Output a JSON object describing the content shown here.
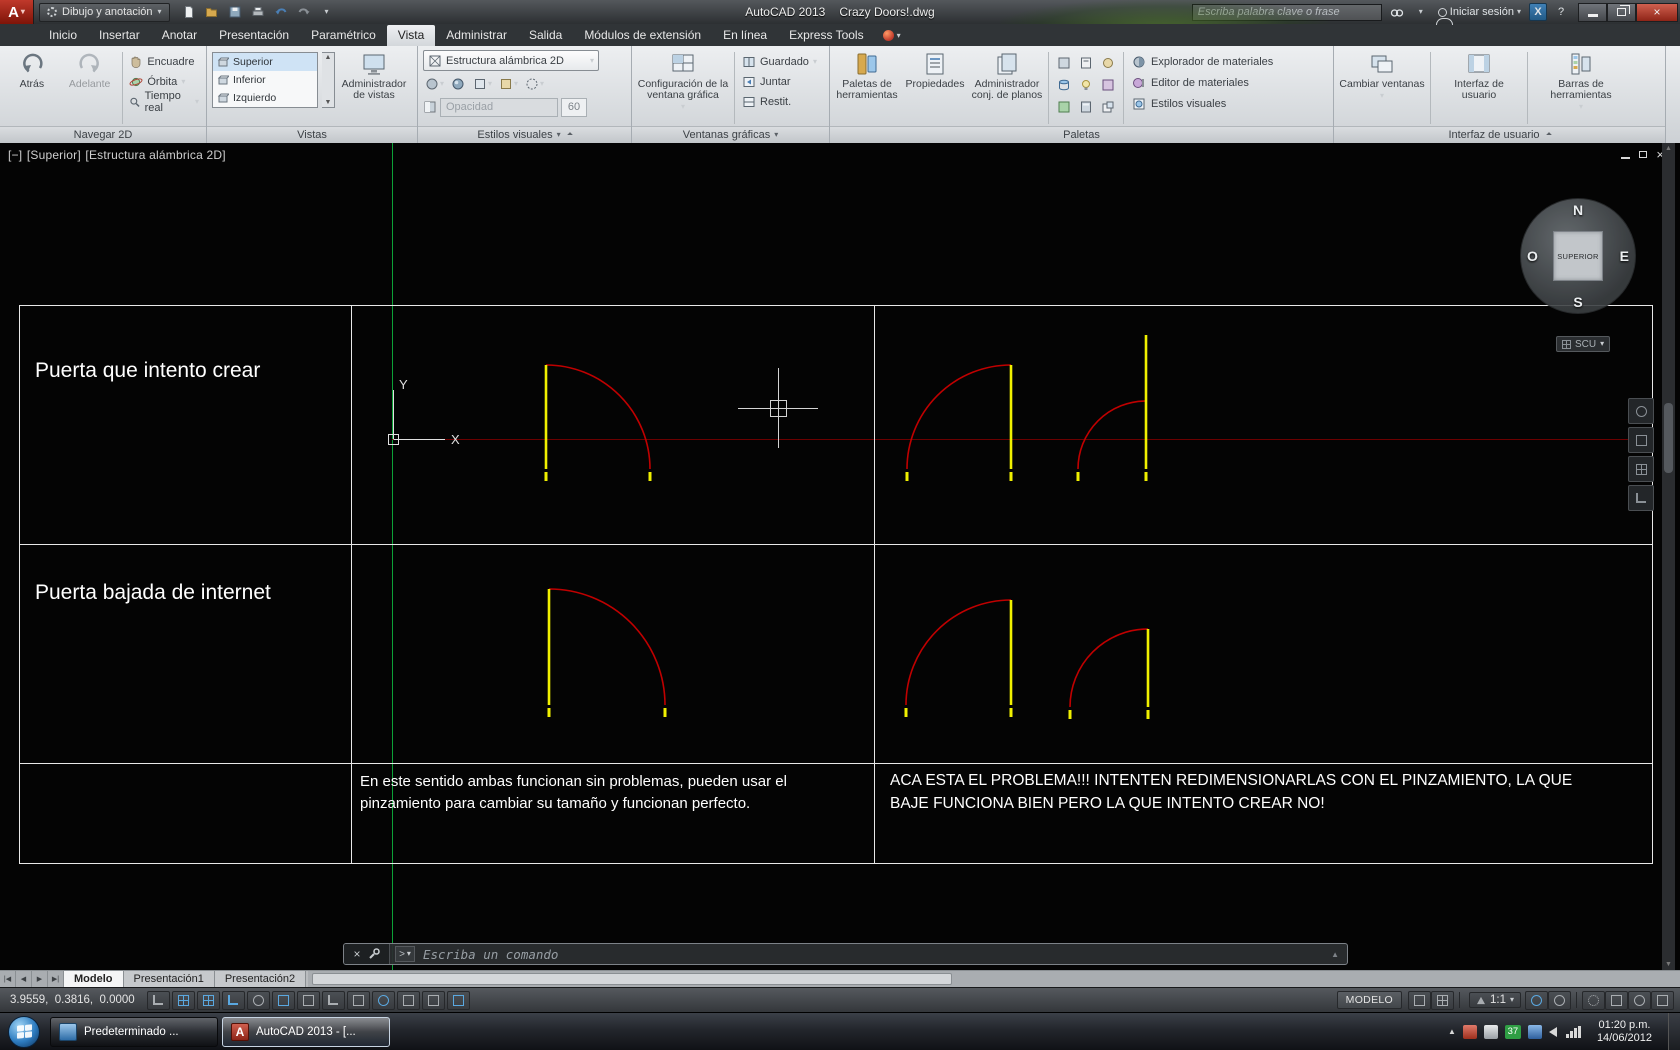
{
  "glyphs": {
    "dropdown": "▾",
    "close": "×",
    "up": "▲",
    "down": "▼",
    "tab_first": "|◀",
    "tab_prev": "◀",
    "tab_next": "▶",
    "tab_last": "▶|",
    "prompt": ">",
    "help": "?"
  },
  "title_bar": {
    "logo_letter": "A",
    "workspace": "Dibujo y anotación",
    "app_name": "AutoCAD 2013",
    "doc_name": "Crazy Doors!.dwg",
    "search_placeholder": "Escriba palabra clave o frase",
    "sign_in": "Iniciar sesión",
    "exchange_label": "X"
  },
  "menu": {
    "items": [
      "Inicio",
      "Insertar",
      "Anotar",
      "Presentación",
      "Paramétrico",
      "Vista",
      "Administrar",
      "Salida",
      "Módulos de extensión",
      "En línea",
      "Express Tools"
    ]
  },
  "ribbon": {
    "navegar": {
      "label": "Navegar 2D",
      "back": "Atrás",
      "forward": "Adelante",
      "pan": "Encuadre",
      "orbit": "Órbita",
      "realtime": "Tiempo real"
    },
    "vistas": {
      "label": "Vistas",
      "items": [
        "Superior",
        "Inferior",
        "Izquierdo"
      ],
      "manager": "Administrador de vistas"
    },
    "estilos": {
      "label": "Estilos visuales",
      "current": "Estructura alámbrica 2D",
      "opacity_label": "Opacidad",
      "opacity_value": "60"
    },
    "ventanas": {
      "label": "Ventanas gráficas",
      "config": "Configuración de la ventana gráfica",
      "saved": "Guardado",
      "join": "Juntar",
      "restore": "Restit."
    },
    "paletas": {
      "label": "Paletas",
      "tool_palettes": "Paletas de herramientas",
      "properties": "Propiedades",
      "sheet_set": "Administrador conj. de planos",
      "mat_browser": "Explorador de materiales",
      "mat_editor": "Editor de materiales",
      "visual_styles": "Estilos visuales"
    },
    "interfaz": {
      "label": "Interfaz de usuario",
      "switch_windows": "Cambiar ventanas",
      "user_interface": "Interfaz de usuario",
      "toolbars": "Barras de herramientas"
    }
  },
  "viewport": {
    "ctrl_minus": "[−]",
    "ctrl_view": "[Superior]",
    "ctrl_style": "[Estructura alámbrica 2D]",
    "cube_n": "N",
    "cube_e": "E",
    "cube_s": "S",
    "cube_o": "O",
    "cube_face": "SUPERIOR",
    "scu": "SCU",
    "ucs_x": "X",
    "ucs_y": "Y"
  },
  "canvas_table": {
    "row1_label": "Puerta que intento crear",
    "row2_label": "Puerta bajada de internet",
    "note_ok": "En este sentido ambas funcionan sin problemas, pueden usar el pinzamiento para cambiar su tamaño y funcionan perfecto.",
    "note_problem": "ACA ESTA EL PROBLEMA!!! INTENTEN REDIMENSIONARLAS CON EL PINZAMIENTO, LA QUE BAJE FUNCIONA BIEN PERO LA QUE INTENTO CREAR NO!"
  },
  "command_line": {
    "prompt": "Escriba un comando"
  },
  "layout_tabs": {
    "model": "Modelo",
    "p1": "Presentación1",
    "p2": "Presentación2"
  },
  "status_bar": {
    "coords": "3.9559,  0.3816,  0.0000",
    "modelo": "MODELO",
    "scale": "1:1"
  },
  "taskbar": {
    "app1": "Predeterminado ...",
    "app2": "AutoCAD 2013 - [...",
    "badge": "37",
    "time": "01:20 p.m.",
    "date": "14/06/2012"
  },
  "colors": {
    "door_line": "#f0f000",
    "door_arc": "#c00000",
    "axis_y_green": "#0ca137",
    "axis_x_red": "#6b0000",
    "active_tool_blue": "#5aa8e0"
  }
}
